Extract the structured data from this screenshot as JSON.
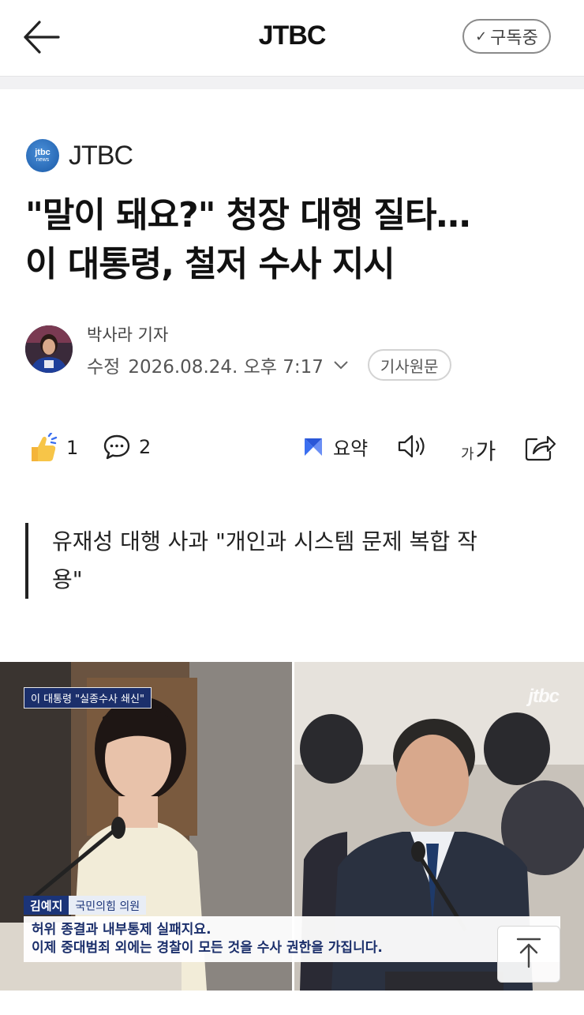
{
  "topbar": {
    "title": "JTBC",
    "subscribe_label": "구독중",
    "subscribe_icon": "check-icon"
  },
  "source": {
    "logo_line1": "jtbc",
    "logo_line2": "news",
    "name": "JTBC"
  },
  "article": {
    "headline_line1": "\"말이 돼요?\" 청장 대행 질타…",
    "headline_line2": "이 대통령, 철저 수사 지시",
    "reporter": "박사라 기자",
    "modified_label": "수정",
    "timestamp": "2026.08.24. 오후 7:17",
    "origin_button": "기사원문",
    "subhead_line1": "유재성 대행 사과 \"개인과 시스템 문제 복합 작",
    "subhead_line2": "용\""
  },
  "actions": {
    "like_count": "1",
    "comment_count": "2",
    "summary_label": "요약",
    "font_small": "가",
    "font_large": "가"
  },
  "photo": {
    "top_tag": "이 대통령 \"실종수사 쇄신\"",
    "watermark": "jtbc",
    "name": "김예지",
    "role": "국민의힘 의원",
    "caption_line1": "허위 종결과 내부통제 실패지요.",
    "caption_line2": "이제 중대범죄 외에는 경찰이 모든 것을 수사 권한을 가집니다."
  },
  "colors": {
    "accent_navy": "#1b2f6b",
    "summary_icon": "#3b6ff0"
  }
}
